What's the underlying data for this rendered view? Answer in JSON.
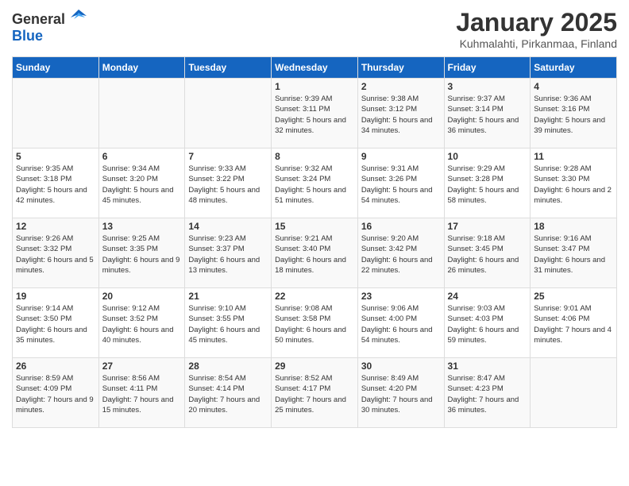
{
  "header": {
    "logo_general": "General",
    "logo_blue": "Blue",
    "title": "January 2025",
    "subtitle": "Kuhmalahti, Pirkanmaa, Finland"
  },
  "weekdays": [
    "Sunday",
    "Monday",
    "Tuesday",
    "Wednesday",
    "Thursday",
    "Friday",
    "Saturday"
  ],
  "weeks": [
    [
      {
        "day": "",
        "info": ""
      },
      {
        "day": "",
        "info": ""
      },
      {
        "day": "",
        "info": ""
      },
      {
        "day": "1",
        "info": "Sunrise: 9:39 AM\nSunset: 3:11 PM\nDaylight: 5 hours and 32 minutes."
      },
      {
        "day": "2",
        "info": "Sunrise: 9:38 AM\nSunset: 3:12 PM\nDaylight: 5 hours and 34 minutes."
      },
      {
        "day": "3",
        "info": "Sunrise: 9:37 AM\nSunset: 3:14 PM\nDaylight: 5 hours and 36 minutes."
      },
      {
        "day": "4",
        "info": "Sunrise: 9:36 AM\nSunset: 3:16 PM\nDaylight: 5 hours and 39 minutes."
      }
    ],
    [
      {
        "day": "5",
        "info": "Sunrise: 9:35 AM\nSunset: 3:18 PM\nDaylight: 5 hours and 42 minutes."
      },
      {
        "day": "6",
        "info": "Sunrise: 9:34 AM\nSunset: 3:20 PM\nDaylight: 5 hours and 45 minutes."
      },
      {
        "day": "7",
        "info": "Sunrise: 9:33 AM\nSunset: 3:22 PM\nDaylight: 5 hours and 48 minutes."
      },
      {
        "day": "8",
        "info": "Sunrise: 9:32 AM\nSunset: 3:24 PM\nDaylight: 5 hours and 51 minutes."
      },
      {
        "day": "9",
        "info": "Sunrise: 9:31 AM\nSunset: 3:26 PM\nDaylight: 5 hours and 54 minutes."
      },
      {
        "day": "10",
        "info": "Sunrise: 9:29 AM\nSunset: 3:28 PM\nDaylight: 5 hours and 58 minutes."
      },
      {
        "day": "11",
        "info": "Sunrise: 9:28 AM\nSunset: 3:30 PM\nDaylight: 6 hours and 2 minutes."
      }
    ],
    [
      {
        "day": "12",
        "info": "Sunrise: 9:26 AM\nSunset: 3:32 PM\nDaylight: 6 hours and 5 minutes."
      },
      {
        "day": "13",
        "info": "Sunrise: 9:25 AM\nSunset: 3:35 PM\nDaylight: 6 hours and 9 minutes."
      },
      {
        "day": "14",
        "info": "Sunrise: 9:23 AM\nSunset: 3:37 PM\nDaylight: 6 hours and 13 minutes."
      },
      {
        "day": "15",
        "info": "Sunrise: 9:21 AM\nSunset: 3:40 PM\nDaylight: 6 hours and 18 minutes."
      },
      {
        "day": "16",
        "info": "Sunrise: 9:20 AM\nSunset: 3:42 PM\nDaylight: 6 hours and 22 minutes."
      },
      {
        "day": "17",
        "info": "Sunrise: 9:18 AM\nSunset: 3:45 PM\nDaylight: 6 hours and 26 minutes."
      },
      {
        "day": "18",
        "info": "Sunrise: 9:16 AM\nSunset: 3:47 PM\nDaylight: 6 hours and 31 minutes."
      }
    ],
    [
      {
        "day": "19",
        "info": "Sunrise: 9:14 AM\nSunset: 3:50 PM\nDaylight: 6 hours and 35 minutes."
      },
      {
        "day": "20",
        "info": "Sunrise: 9:12 AM\nSunset: 3:52 PM\nDaylight: 6 hours and 40 minutes."
      },
      {
        "day": "21",
        "info": "Sunrise: 9:10 AM\nSunset: 3:55 PM\nDaylight: 6 hours and 45 minutes."
      },
      {
        "day": "22",
        "info": "Sunrise: 9:08 AM\nSunset: 3:58 PM\nDaylight: 6 hours and 50 minutes."
      },
      {
        "day": "23",
        "info": "Sunrise: 9:06 AM\nSunset: 4:00 PM\nDaylight: 6 hours and 54 minutes."
      },
      {
        "day": "24",
        "info": "Sunrise: 9:03 AM\nSunset: 4:03 PM\nDaylight: 6 hours and 59 minutes."
      },
      {
        "day": "25",
        "info": "Sunrise: 9:01 AM\nSunset: 4:06 PM\nDaylight: 7 hours and 4 minutes."
      }
    ],
    [
      {
        "day": "26",
        "info": "Sunrise: 8:59 AM\nSunset: 4:09 PM\nDaylight: 7 hours and 9 minutes."
      },
      {
        "day": "27",
        "info": "Sunrise: 8:56 AM\nSunset: 4:11 PM\nDaylight: 7 hours and 15 minutes."
      },
      {
        "day": "28",
        "info": "Sunrise: 8:54 AM\nSunset: 4:14 PM\nDaylight: 7 hours and 20 minutes."
      },
      {
        "day": "29",
        "info": "Sunrise: 8:52 AM\nSunset: 4:17 PM\nDaylight: 7 hours and 25 minutes."
      },
      {
        "day": "30",
        "info": "Sunrise: 8:49 AM\nSunset: 4:20 PM\nDaylight: 7 hours and 30 minutes."
      },
      {
        "day": "31",
        "info": "Sunrise: 8:47 AM\nSunset: 4:23 PM\nDaylight: 7 hours and 36 minutes."
      },
      {
        "day": "",
        "info": ""
      }
    ]
  ]
}
